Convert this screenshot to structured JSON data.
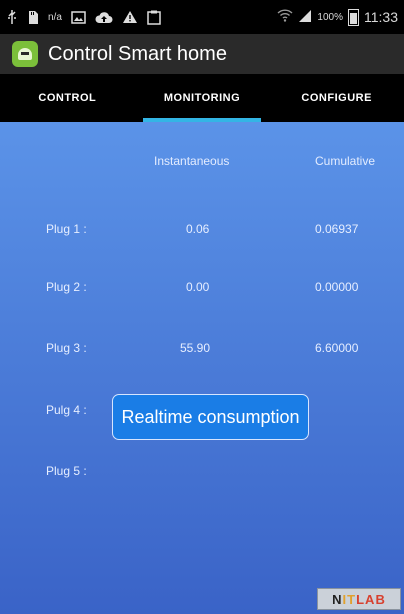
{
  "status_bar": {
    "signal_label": "n/a",
    "battery_percent": "100%",
    "time": "11:33"
  },
  "app_bar": {
    "title": "Control Smart home"
  },
  "tabs": [
    {
      "label": "CONTROL",
      "active": false
    },
    {
      "label": "MONITORING",
      "active": true
    },
    {
      "label": "CONFIGURE",
      "active": false
    }
  ],
  "table": {
    "headers": {
      "instantaneous": "Instantaneous",
      "cumulative": "Cumulative"
    },
    "rows": [
      {
        "label": "Plug 1 :",
        "instantaneous": "0.06",
        "cumulative": "0.06937"
      },
      {
        "label": "Plug 2 :",
        "instantaneous": "0.00",
        "cumulative": "0.00000"
      },
      {
        "label": "Plug 3 :",
        "instantaneous": "55.90",
        "cumulative": "6.60000"
      },
      {
        "label": "Pulg 4 :",
        "instantaneous": "",
        "cumulative": ""
      },
      {
        "label": "Plug 5 :",
        "instantaneous": "",
        "cumulative": ""
      }
    ]
  },
  "button": {
    "label": "Realtime consumption"
  },
  "logo": {
    "part1": "N",
    "part2": "IT",
    "part3": "LAB"
  },
  "colors": {
    "tab_indicator": "#33b5e5",
    "content_bg": "#4f80dd",
    "button_bg": "#1a7de6"
  }
}
